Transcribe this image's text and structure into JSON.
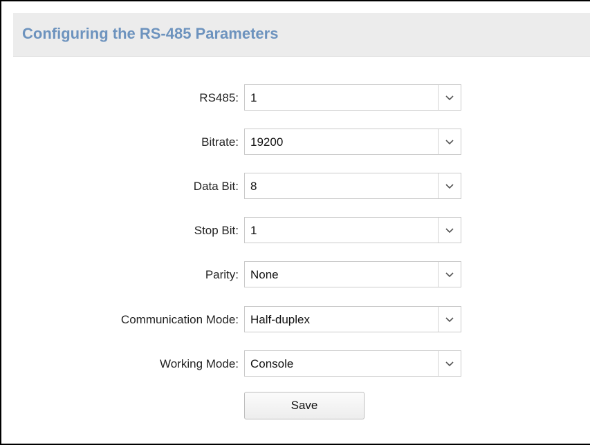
{
  "header": {
    "title": "Configuring the RS-485 Parameters"
  },
  "form": {
    "rs485": {
      "label": "RS485:",
      "value": "1"
    },
    "bitrate": {
      "label": "Bitrate:",
      "value": "19200"
    },
    "data_bit": {
      "label": "Data Bit:",
      "value": "8"
    },
    "stop_bit": {
      "label": "Stop Bit:",
      "value": "1"
    },
    "parity": {
      "label": "Parity:",
      "value": "None"
    },
    "communication_mode": {
      "label": "Communication Mode:",
      "value": "Half-duplex"
    },
    "working_mode": {
      "label": "Working Mode:",
      "value": "Console"
    }
  },
  "actions": {
    "save_label": "Save"
  },
  "icons": {
    "dropdown": "chevron-down-icon"
  },
  "colors": {
    "title": "#6d93be",
    "header_bg": "#ececec"
  }
}
